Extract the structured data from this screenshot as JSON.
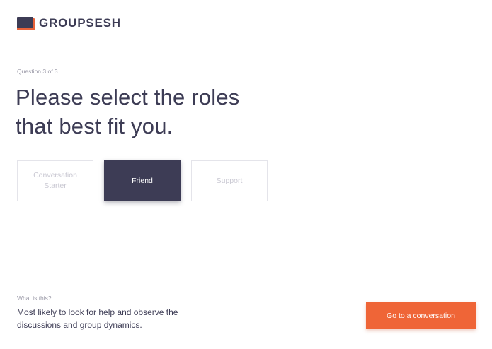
{
  "brand": {
    "name": "GROUPSESH",
    "logo_icon": "chat-bubble-icon",
    "colors": {
      "dark": "#3d3c55",
      "accent": "#ef6537"
    }
  },
  "progress": {
    "label": "Question 3 of 3",
    "current": 3,
    "total": 3
  },
  "question": {
    "title_line1": "Please select the roles",
    "title_line2": "that best fit you."
  },
  "roles": [
    {
      "label_line1": "Conversation",
      "label_line2": "Starter",
      "selected": false
    },
    {
      "label": "Friend",
      "selected": true
    },
    {
      "label": "Support",
      "selected": false
    }
  ],
  "info": {
    "label": "What is this?",
    "description": "Most likely to look for help and observe the discussions and group dynamics."
  },
  "cta": {
    "label": "Go to a conversation"
  }
}
